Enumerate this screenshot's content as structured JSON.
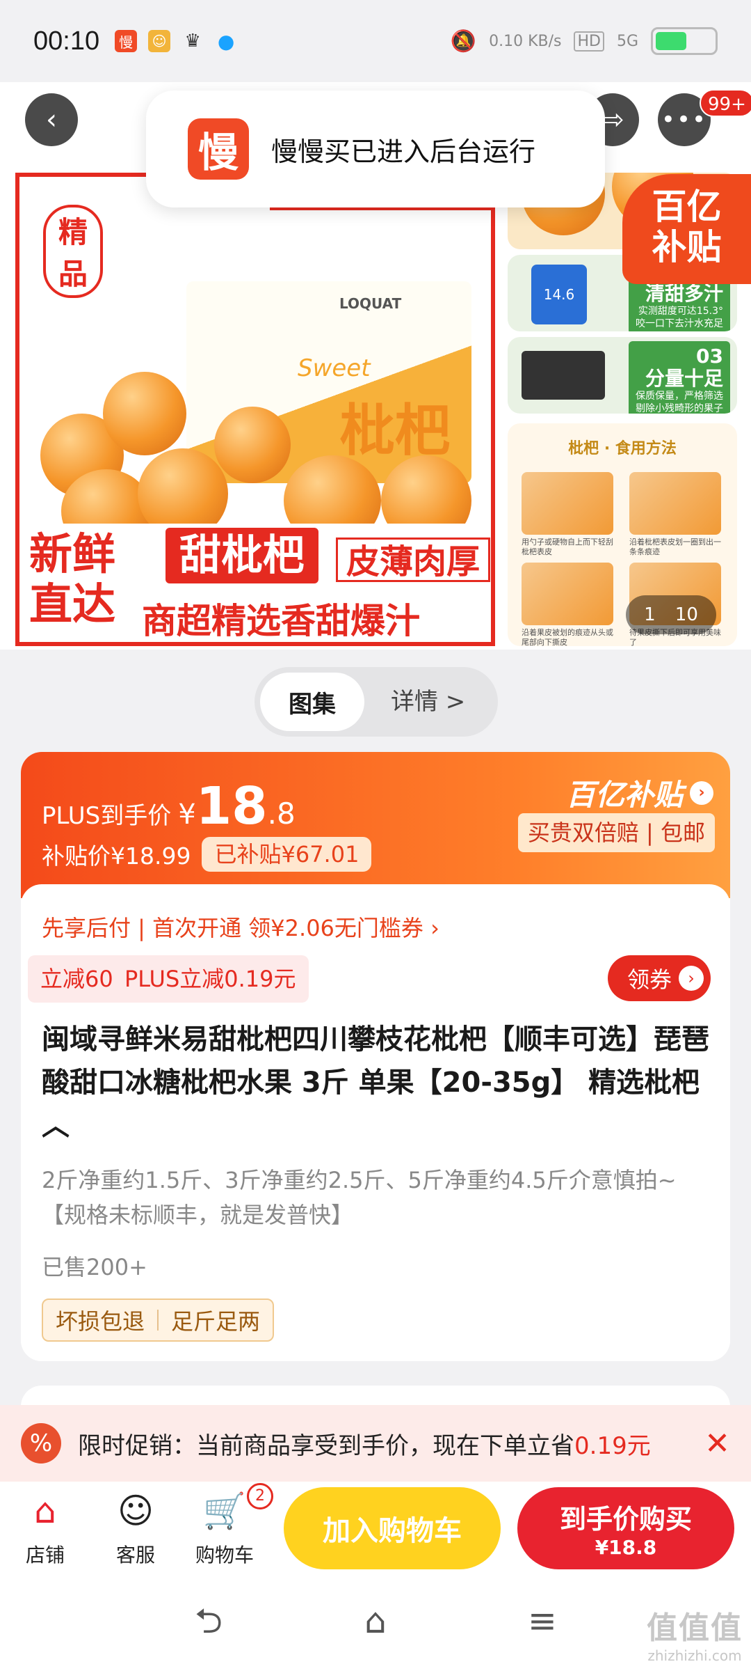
{
  "status_bar": {
    "time": "00:10",
    "network_speed": "0.10 KB/s",
    "hd": "HD",
    "signal": "5G"
  },
  "nav": {
    "back_icon": "back-arrow-icon",
    "share_icon": "share-icon",
    "more_icon": "more-icon",
    "more_badge": "99+"
  },
  "toast": {
    "icon_text": "慢",
    "text": "慢慢买已进入后台运行"
  },
  "hero": {
    "quality_badge": "精品",
    "slogan_left": "新鲜\n直达",
    "slogan_tag": "甜枇杷",
    "slogan_tag2": "皮薄肉厚",
    "slogan_bottom": "商超精选香甜爆汁",
    "box_brand": "枇杷",
    "box_label": "LOQUAT",
    "box_sweet": "Sweet",
    "billion_badge": "百亿\n补贴",
    "side_labels": [
      {
        "title": "清甜多汁",
        "sub": "实测甜度可达15.3°\n咬一口下去汁水充足"
      },
      {
        "title": "03\n分量十足",
        "sub": "保质保量，严格筛选\n剔除小残畸形的果子"
      }
    ],
    "method_title": "枇杷 · 食用方法",
    "method_captions": [
      "用勺子或硬物自上而下轻刮枇杷表皮",
      "沿着枇杷表皮划一圈到出一条条痕迹",
      "沿着果皮被划的痕迹从头或尾部向下撕皮",
      "待果皮撕下后即可享用美味了"
    ],
    "counter_current": "1",
    "counter_total": "10"
  },
  "gallery_switch": {
    "active": "图集",
    "other": "详情 >"
  },
  "price": {
    "plus_label": "PLUS到手价",
    "currency": "¥",
    "price_int": "18",
    "price_dec": ".8",
    "subsidy_price": "补贴价¥18.99",
    "subsidy_tag": "已补贴¥67.01",
    "billion_title": "百亿补贴",
    "guarantee": "买贵双倍赔 | 包邮"
  },
  "info": {
    "credit_line": "先享后付 | 首次开通 领¥2.06无门槛券 ›",
    "promo_chips": [
      "立减60",
      "PLUS立减0.19元"
    ],
    "coupon_button": "领券",
    "title": "闽域寻鲜米易甜枇杷四川攀枝花枇杷【顺丰可选】琵琶酸甜口冰糖枇杷水果 3斤 单果【20-35g】 精选枇杷 ︿",
    "description": "2斤净重约1.5斤、3斤净重约2.5斤、5斤净重约4.5斤介意慎拍~【规格未标顺丰，就是发普快】",
    "sold": "已售200+",
    "service_tags": [
      "坏损包退",
      "足斤足两"
    ]
  },
  "promo_banner": {
    "icon": "%",
    "text": "限时促销：当前商品享受到手价，现在下单立省",
    "amount": "0.19元",
    "close": "✕"
  },
  "bottom_bar": {
    "store": "店铺",
    "service": "客服",
    "cart": "购物车",
    "cart_count": "2",
    "add_to_cart": "加入购物车",
    "buy_line1": "到手价购买",
    "buy_line2": "¥18.8"
  },
  "watermark": {
    "line1": "值值值",
    "line2": "zhizhizhi.com"
  },
  "colors": {
    "accent_red": "#e52a20",
    "accent_orange": "#f44a1a",
    "yellow": "#ffd21f"
  }
}
